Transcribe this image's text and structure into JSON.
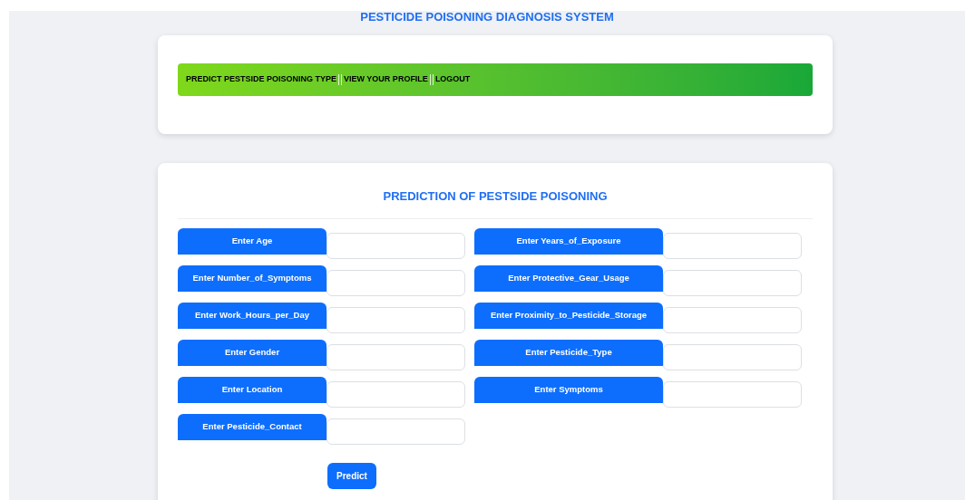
{
  "title": "PESTICIDE POISONING DIAGNOSIS SYSTEM",
  "nav": {
    "links": [
      "PREDICT PESTSIDE POISONING TYPE",
      "VIEW YOUR PROFILE",
      "LOGOUT"
    ]
  },
  "form": {
    "heading": "PREDICTION OF PESTSIDE POISONING",
    "columns": [
      {
        "fields": [
          {
            "label": "Enter Age"
          },
          {
            "label": "Enter Number_of_Symptoms"
          },
          {
            "label": "Enter Work_Hours_per_Day"
          },
          {
            "label": "Enter Gender"
          },
          {
            "label": "Enter Location"
          },
          {
            "label": "Enter Pesticide_Contact"
          }
        ]
      },
      {
        "fields": [
          {
            "label": "Enter Years_of_Exposure"
          },
          {
            "label": "Enter Protective_Gear_Usage"
          },
          {
            "label": "Enter Proximity_to_Pesticide_Storage"
          },
          {
            "label": "Enter Pesticide_Type"
          },
          {
            "label": "Enter Symptoms"
          }
        ]
      }
    ],
    "submit": "Predict"
  }
}
